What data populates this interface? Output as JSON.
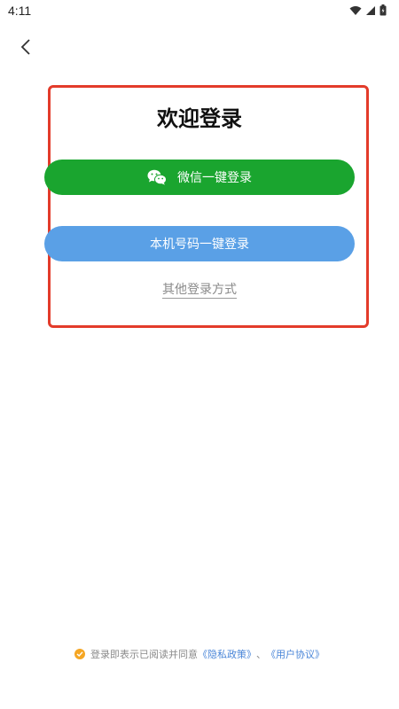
{
  "status_bar": {
    "time": "4:11",
    "icons": [
      "wifi-icon",
      "signal-icon",
      "battery-icon"
    ]
  },
  "header": {
    "back_icon": "chevron-left-icon"
  },
  "main": {
    "title": "欢迎登录",
    "wechat_button": {
      "label": "微信一键登录",
      "icon": "wechat-icon",
      "color": "#1aa52f"
    },
    "phone_button": {
      "label": "本机号码一键登录",
      "color": "#5aa0e6"
    },
    "other_login": "其他登录方式",
    "highlight_color": "#e33b2a"
  },
  "footer": {
    "agreement_prefix": "登录即表示已阅读并同意",
    "privacy_link": "《隐私政策》",
    "separator": "、",
    "user_agreement_link": "《用户协议》",
    "check_color": "#f5a623"
  }
}
